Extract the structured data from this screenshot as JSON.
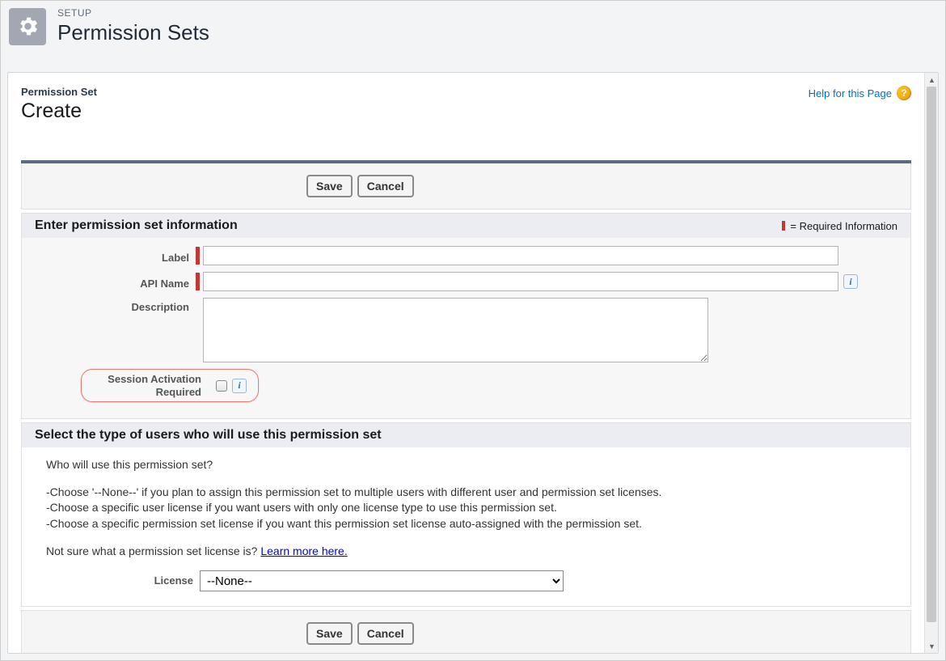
{
  "header": {
    "kicker": "SETUP",
    "title": "Permission Sets"
  },
  "page": {
    "kicker": "Permission Set",
    "title": "Create",
    "help_link_text": "Help for this Page"
  },
  "buttons": {
    "save": "Save",
    "cancel": "Cancel"
  },
  "section1": {
    "heading": "Enter permission set information",
    "required_legend": "= Required Information",
    "labels": {
      "label": "Label",
      "api_name": "API Name",
      "description": "Description",
      "session": "Session Activation Required"
    },
    "values": {
      "label": "",
      "api_name": "",
      "description": ""
    }
  },
  "section2": {
    "heading": "Select the type of users who will use this permission set",
    "intro": "Who will use this permission set?",
    "choice1": "-Choose '--None--' if you plan to assign this permission set to multiple users with different user and permission set licenses.",
    "choice2": "-Choose a specific user license if you want users with only one license type to use this permission set.",
    "choice3": "-Choose a specific permission set license if you want this permission set license auto-assigned with the permission set.",
    "learn_intro": "Not sure what a permission set license is? ",
    "learn_link": "Learn more here.",
    "license_label": "License",
    "license_value": "--None--"
  }
}
